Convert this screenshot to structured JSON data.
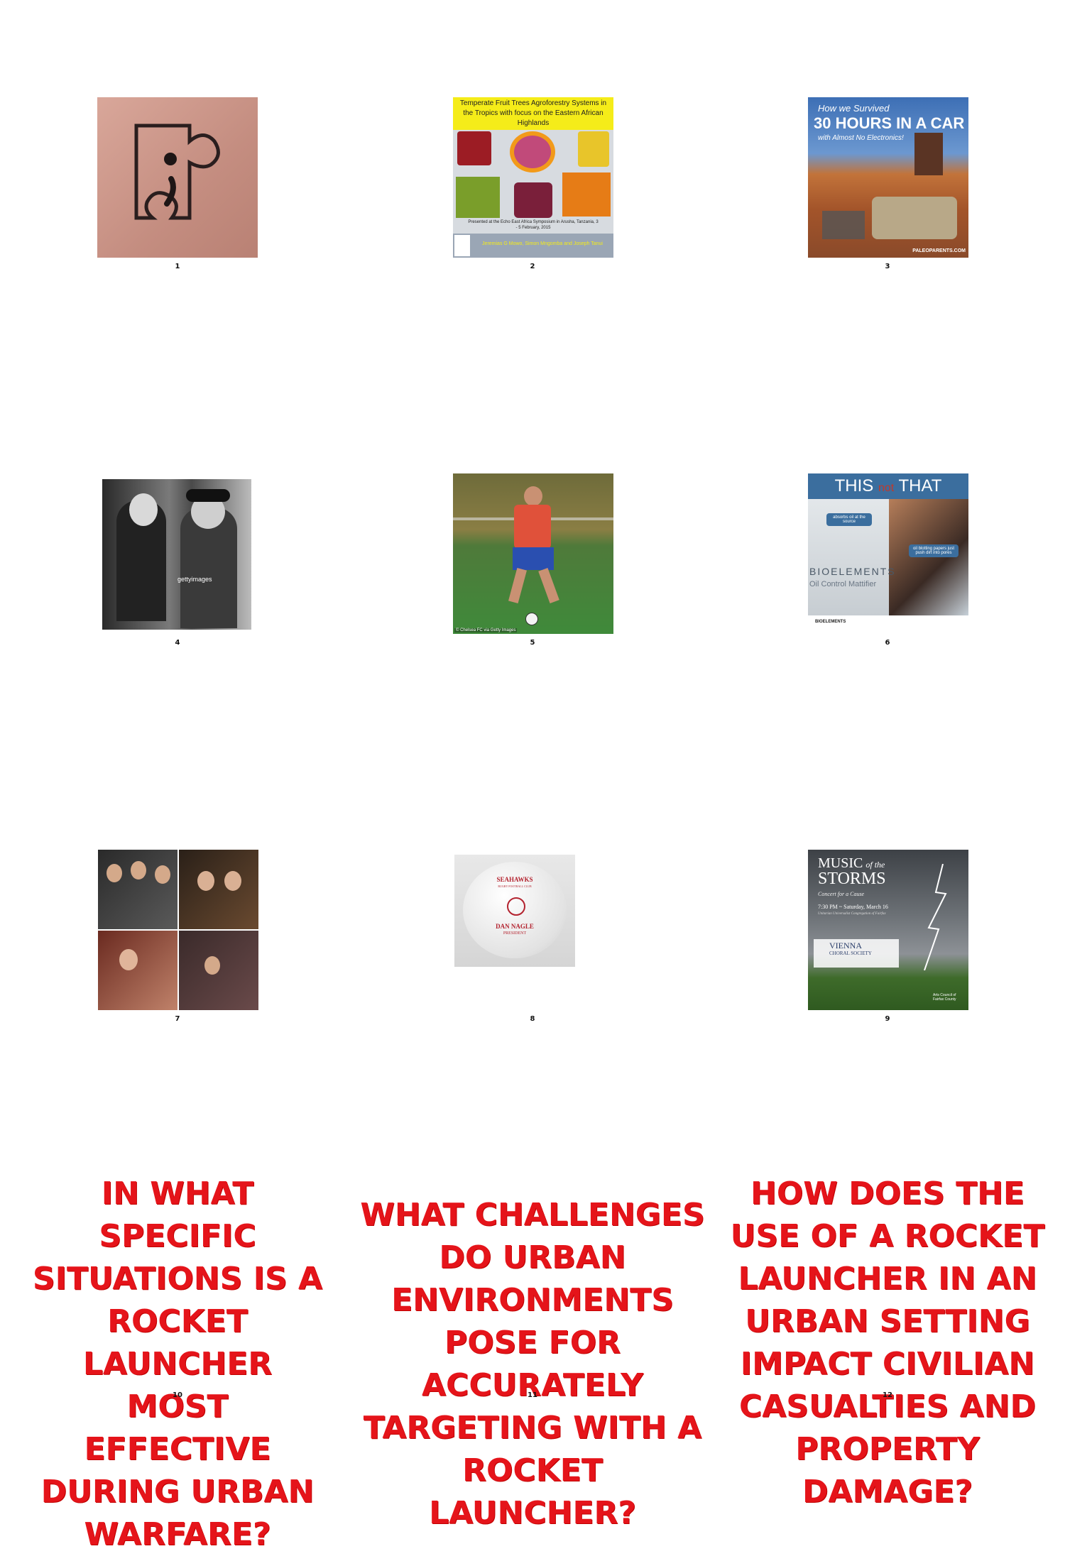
{
  "cells": [
    {
      "number": "1"
    },
    {
      "number": "2",
      "title": "Temperate Fruit Trees Agroforestry Systems in the Tropics with focus on the Eastern African Highlands",
      "subtitle": "Presented at the Echo East Africa Symposium in Arusha, Tanzania, 3 - 5 February, 2015",
      "authors": "Jeremias G Mowo, Simon Mngomba and Joseph Tanui"
    },
    {
      "number": "3",
      "title_line1": "How we Survived",
      "title_line2": "30 HOURS IN A CAR",
      "title_line3": "with Almost No Electronics!",
      "credit": "PALEOPARENTS.COM"
    },
    {
      "number": "4",
      "watermark": "gettyimages"
    },
    {
      "number": "5",
      "credit": "© Chelsea FC via Getty Images"
    },
    {
      "number": "6",
      "title_left": "THIS",
      "title_mid": "not",
      "title_right": "THAT",
      "bubble1": "absorbs oil at the source",
      "bubble2": "oil blotting papers just push dirt into pores",
      "product": "BIOELEMENTS",
      "product_sub": "Oil Control Mattifier",
      "brand": "BIOELEMENTS"
    },
    {
      "number": "7"
    },
    {
      "number": "8",
      "club": "SEAHAWKS",
      "club_sub": "RUGBY FOOTBALL CLUB",
      "name": "DAN NAGLE",
      "role": "PRESIDENT"
    },
    {
      "number": "9",
      "title_a": "MUSIC",
      "title_of": "of the",
      "title_b": "STORMS",
      "tagline": "Concert for a Cause",
      "time": "7:30 PM ~ Saturday, March 16",
      "venue": "Unitarian Universalist Congregation of Fairfax",
      "org": "VIENNA",
      "org_sub": "CHORAL SOCIETY",
      "sponsor": "Arts Council of Fairfax County"
    },
    {
      "number": "10",
      "question": "IN WHAT SPECIFIC SITUATIONS IS A ROCKET LAUNCHER MOST EFFECTIVE DURING URBAN WARFARE?"
    },
    {
      "number": "11",
      "question": "WHAT CHALLENGES DO URBAN ENVIRONMENTS POSE FOR ACCURATELY TARGETING WITH A ROCKET LAUNCHER?"
    },
    {
      "number": "12",
      "question": "HOW DOES THE USE OF A ROCKET LAUNCHER IN AN URBAN SETTING IMPACT CIVILIAN CASUALTIES AND PROPERTY DAMAGE?"
    }
  ],
  "colors": {
    "question_red": "#e5141a",
    "page_bg": "#ffffff"
  }
}
